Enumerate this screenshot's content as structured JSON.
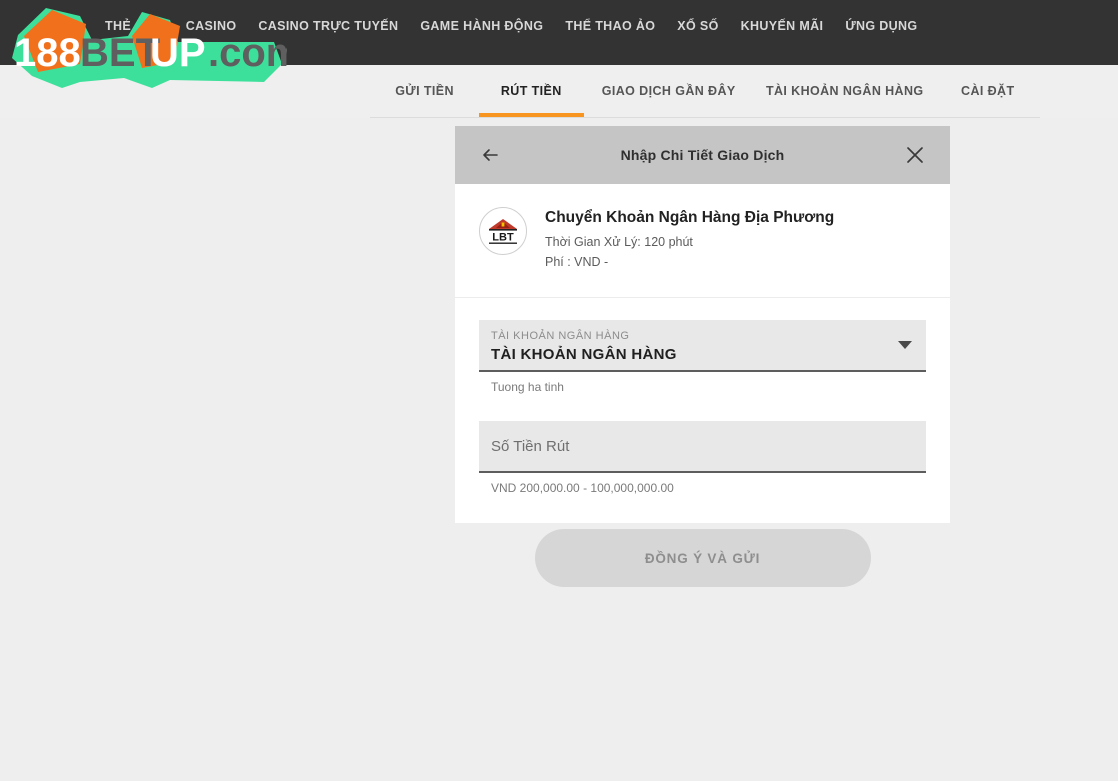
{
  "header": {
    "logo": {
      "name": "188betup-logo",
      "part1": "188",
      "part2": "BET",
      "part3": "UP",
      "part4": ".com",
      "orange": "#f0701c",
      "green": "#3de09b",
      "gray": "#5f5f5f"
    },
    "nav": [
      {
        "label": "THẺ CÀO"
      },
      {
        "label": "CASINO"
      },
      {
        "label": "CASINO TRỰC TUYẾN"
      },
      {
        "label": "GAME HÀNH ĐỘNG"
      },
      {
        "label": "THỂ THAO ẢO"
      },
      {
        "label": "XỔ SỐ"
      },
      {
        "label": "KHUYẾN MÃI"
      },
      {
        "label": "ỨNG DỤNG"
      }
    ],
    "background": "#333333"
  },
  "tabs": {
    "items": [
      {
        "label": "GỬI TIỀN",
        "active": false
      },
      {
        "label": "RÚT TIỀN",
        "active": true
      },
      {
        "label": "GIAO DỊCH GẦN ĐÂY",
        "active": false
      },
      {
        "label": "TÀI KHOẢN NGÂN HÀNG",
        "active": false
      },
      {
        "label": "CÀI ĐẶT",
        "active": false
      }
    ],
    "active_color": "#f79520"
  },
  "modal": {
    "title": "Nhập Chi Tiết Giao Dịch",
    "back_icon": "arrow-left-icon",
    "close_icon": "close-icon",
    "header_bg": "#c5c5c5",
    "method": {
      "logo_text": "LBT",
      "logo_roof_color": "#c0392b",
      "name": "Chuyển Khoản Ngân Hàng Địa Phương",
      "processing_time": "Thời Gian Xử Lý: 120 phút",
      "fee": "Phí : VND -"
    },
    "bank_account_field": {
      "label": "TÀI KHOẢN NGÂN HÀNG",
      "value": "TÀI KHOẢN NGÂN HÀNG",
      "caret_icon": "chevron-down-icon",
      "helper": "Tuong ha tinh"
    },
    "amount_field": {
      "placeholder": "Số Tiền Rút",
      "value": "",
      "helper": "VND 200,000.00 - 100,000,000.00"
    },
    "submit_label": "ĐỒNG Ý VÀ GỬI"
  }
}
